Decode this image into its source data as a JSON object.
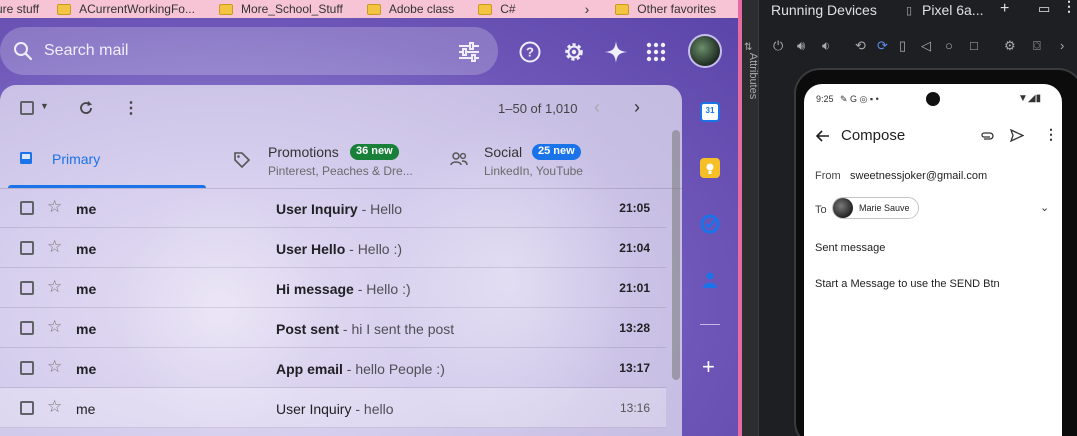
{
  "bookmarks": {
    "first": "ure stuff",
    "items": [
      "ACurrentWorkingFo...",
      "More_School_Stuff",
      "Adobe class",
      "C#"
    ],
    "other": "Other favorites"
  },
  "gmail": {
    "search_placeholder": "Search mail",
    "pagination": "1–50 of 1,010",
    "tabs": [
      {
        "label": "Primary",
        "badge": "",
        "sub": ""
      },
      {
        "label": "Promotions",
        "badge": "36 new",
        "sub": "Pinterest, Peaches & Dre..."
      },
      {
        "label": "Social",
        "badge": "25 new",
        "sub": "LinkedIn, YouTube"
      }
    ],
    "emails": [
      {
        "sender": "me",
        "subject": "User Inquiry",
        "snippet": " - Hello",
        "time": "21:05",
        "unread": true
      },
      {
        "sender": "me",
        "subject": "User Hello",
        "snippet": " - Hello :)",
        "time": "21:04",
        "unread": true
      },
      {
        "sender": "me",
        "subject": "Hi message",
        "snippet": " - Hello :)",
        "time": "21:01",
        "unread": true
      },
      {
        "sender": "me",
        "subject": "Post sent",
        "snippet": " - hi I sent the post",
        "time": "13:28",
        "unread": true
      },
      {
        "sender": "me",
        "subject": "App email",
        "snippet": " - hello People :)",
        "time": "13:17",
        "unread": true
      },
      {
        "sender": "me",
        "subject": "User Inquiry",
        "snippet": " - hello",
        "time": "13:16",
        "unread": false
      }
    ],
    "side_calendar_day": "31"
  },
  "studio": {
    "panel_title": "Running Devices",
    "device_tab": "Pixel 6a...",
    "side_strip_label": "Attributes"
  },
  "phone": {
    "status_time": "9:25",
    "status_icons": "✎ G ◎ ▪ •",
    "app_title": "Compose",
    "from_label": "From",
    "from_value": "sweetnessjoker@gmail.com",
    "to_label": "To",
    "to_chip": "Marie Sauve",
    "subject": "Sent message",
    "body": "Start a Message to use the SEND Btn"
  },
  "colors": {
    "accent_blue": "#1a73e8",
    "badge_green": "#188038",
    "badge_blue": "#1a73e8",
    "bookmarks_bar": "#f7c4d6"
  }
}
